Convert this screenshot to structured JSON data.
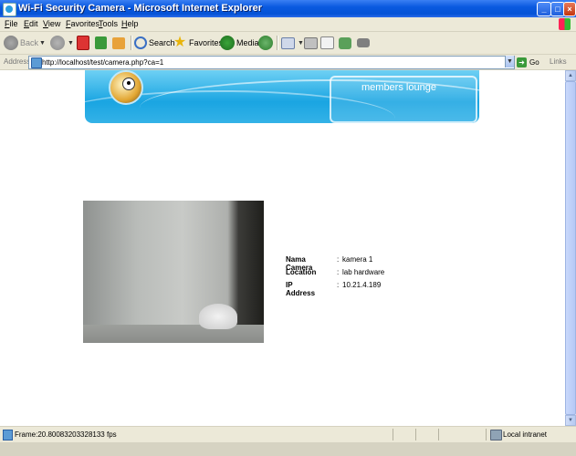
{
  "window": {
    "title": "Wi-Fi Security Camera - Microsoft Internet Explorer",
    "controls": [
      "minimize-icon",
      "maximize-icon",
      "close-icon"
    ]
  },
  "menu": {
    "items": [
      "File",
      "Edit",
      "View",
      "Favorites",
      "Tools",
      "Help"
    ]
  },
  "toolbar": {
    "back_label": "Back",
    "search_label": "Search",
    "favorites_label": "Favorites",
    "media_label": "Media"
  },
  "address": {
    "label": "Address",
    "url": "http://localhost/test/camera.php?ca=1",
    "go_label": "Go",
    "links_label": "Links"
  },
  "page": {
    "banner_text": "members lounge",
    "camera": {
      "rows": [
        {
          "label": "Nama Camera",
          "value": "kamera 1"
        },
        {
          "label": "Location",
          "value": "lab hardware"
        },
        {
          "label": "IP Address",
          "value": "10.21.4.189"
        }
      ]
    }
  },
  "status": {
    "text": "Frame:20.80083203328133 fps",
    "zone": "Local intranet"
  }
}
